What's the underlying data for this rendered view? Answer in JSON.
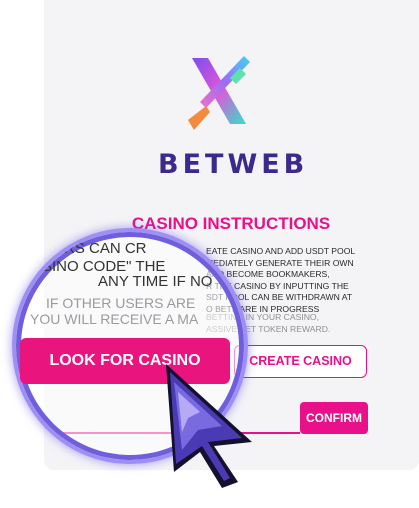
{
  "brand": {
    "name": "BETWEB",
    "logo": "x-mark-gradient-icon"
  },
  "section_title": "CASINO INSTRUCTIONS",
  "instructions_bg": {
    "line1": "EATE CASINO AND ADD USDT POOL",
    "line2": "MEDIATELY GENERATE THEIR OWN",
    "line3": "AND BECOME BOOKMAKERS,",
    "line4": "R THE CASINO BY INPUTTING THE",
    "line5": "SDT POOL CAN BE WITHDRAWN AT",
    "line6": "O BETS ARE IN PROGRESS",
    "line7": "BETTING IN YOUR CASINO,",
    "line8": "ASSIVE BET TOKEN REWARD."
  },
  "magnified": {
    "line1": "ERS CAN CR",
    "line2": "ASINO CODE\"  THE",
    "line3": "ANY TIME IF NO",
    "line4": "IF OTHER USERS ARE",
    "line5": "YOU WILL RECEIVE A MA"
  },
  "buttons": {
    "look_for_casino": "LOOK FOR CASINO",
    "create_casino": "CREATE CASINO",
    "confirm": "CONFIRM"
  },
  "code_input": {
    "placeholder": "",
    "value": ""
  },
  "colors": {
    "accent": "#e8118a",
    "brand": "#3b2a8c",
    "lens": "#9f8ef3"
  },
  "cursor": "pixel-hand-pointer-icon"
}
